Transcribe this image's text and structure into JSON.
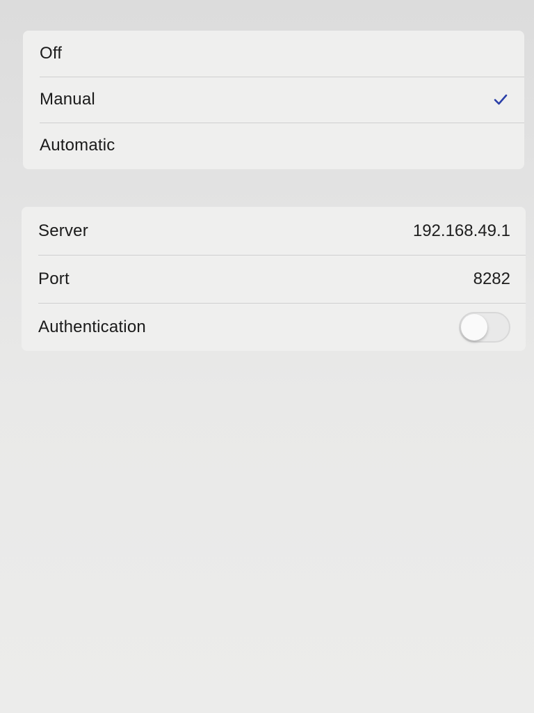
{
  "proxy_mode": {
    "options": [
      {
        "label": "Off",
        "selected": false
      },
      {
        "label": "Manual",
        "selected": true
      },
      {
        "label": "Automatic",
        "selected": false
      }
    ],
    "check_color": "#2a3fa8"
  },
  "proxy_settings": {
    "server_label": "Server",
    "server_value": "192.168.49.1",
    "port_label": "Port",
    "port_value": "8282",
    "authentication_label": "Authentication",
    "authentication_enabled": false
  }
}
